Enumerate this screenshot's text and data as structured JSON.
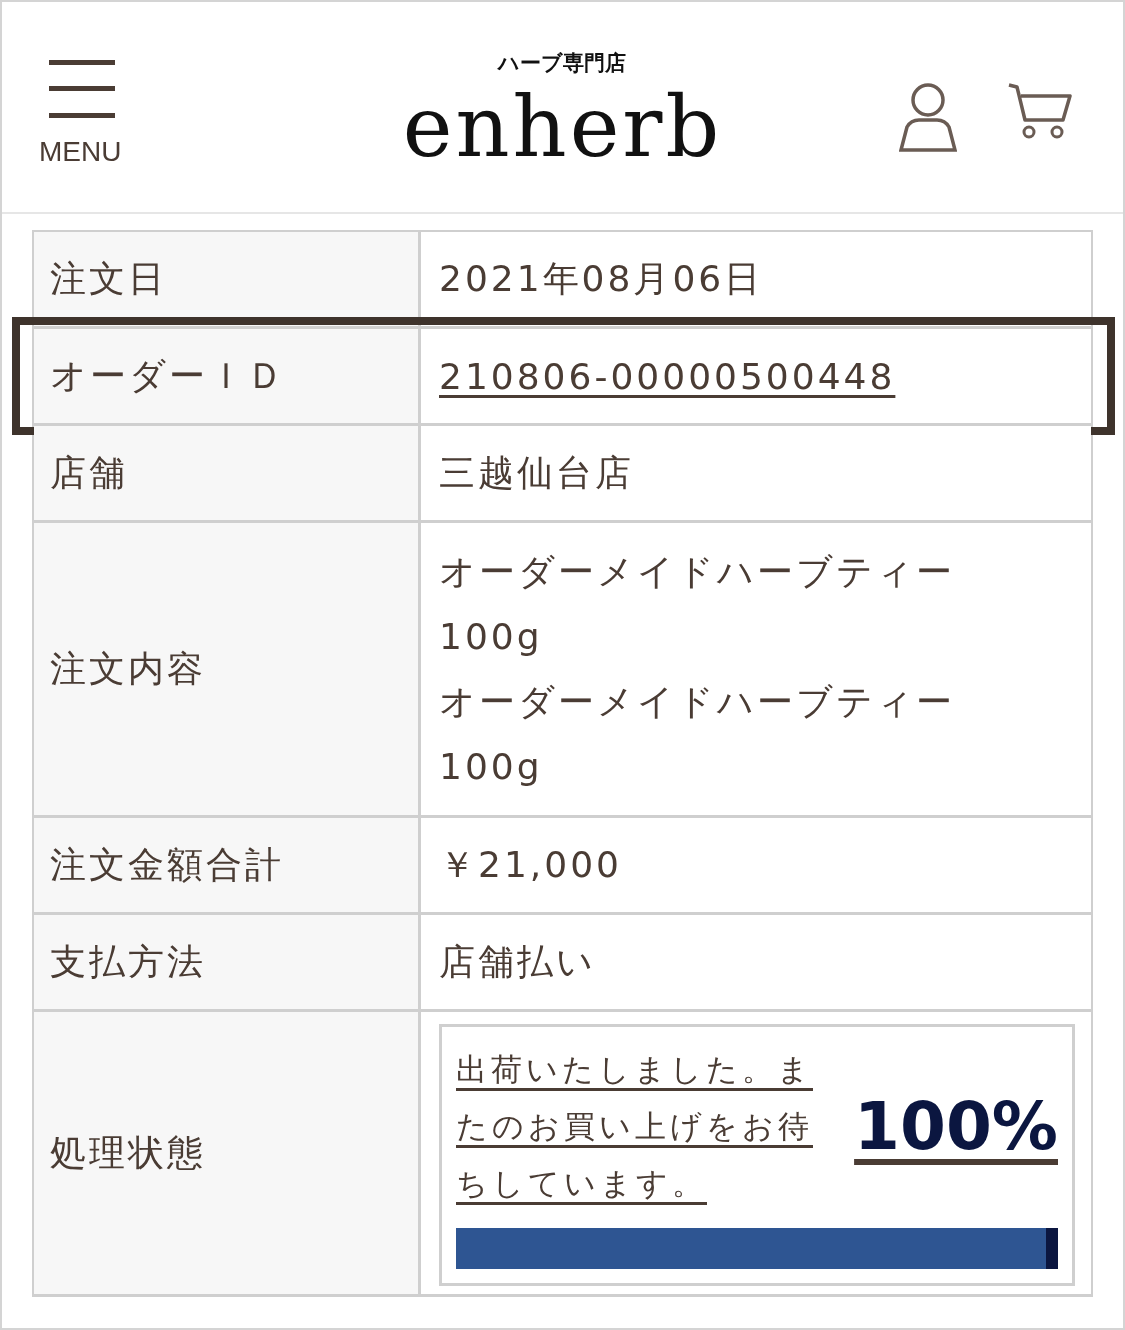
{
  "header": {
    "menu_label": "MENU",
    "tagline": "ハーブ専門店",
    "logo": "enherb"
  },
  "rows": [
    {
      "kind": "text",
      "label": "注文日",
      "value": "2021年08月06日",
      "highlighted": false
    },
    {
      "kind": "link",
      "label": "オーダーＩＤ",
      "value": "210806-00000500448",
      "highlighted": true
    },
    {
      "kind": "text",
      "label": "店舗",
      "value": "三越仙台店",
      "highlighted": false
    },
    {
      "kind": "lines",
      "label": "注文内容",
      "lines": [
        "オーダーメイドハーブティー",
        "100g",
        "オーダーメイドハーブティー",
        "100g"
      ],
      "highlighted": false
    },
    {
      "kind": "text",
      "label": "注文金額合計",
      "value": "￥21,000",
      "highlighted": false
    },
    {
      "kind": "text",
      "label": "支払方法",
      "value": "店舗払い",
      "highlighted": false
    },
    {
      "kind": "status",
      "label": "処理状態",
      "message": "出荷いたしました。またのお買い上げをお待ちしています。",
      "percent": "100%",
      "level": 1,
      "highlighted": false
    }
  ]
}
